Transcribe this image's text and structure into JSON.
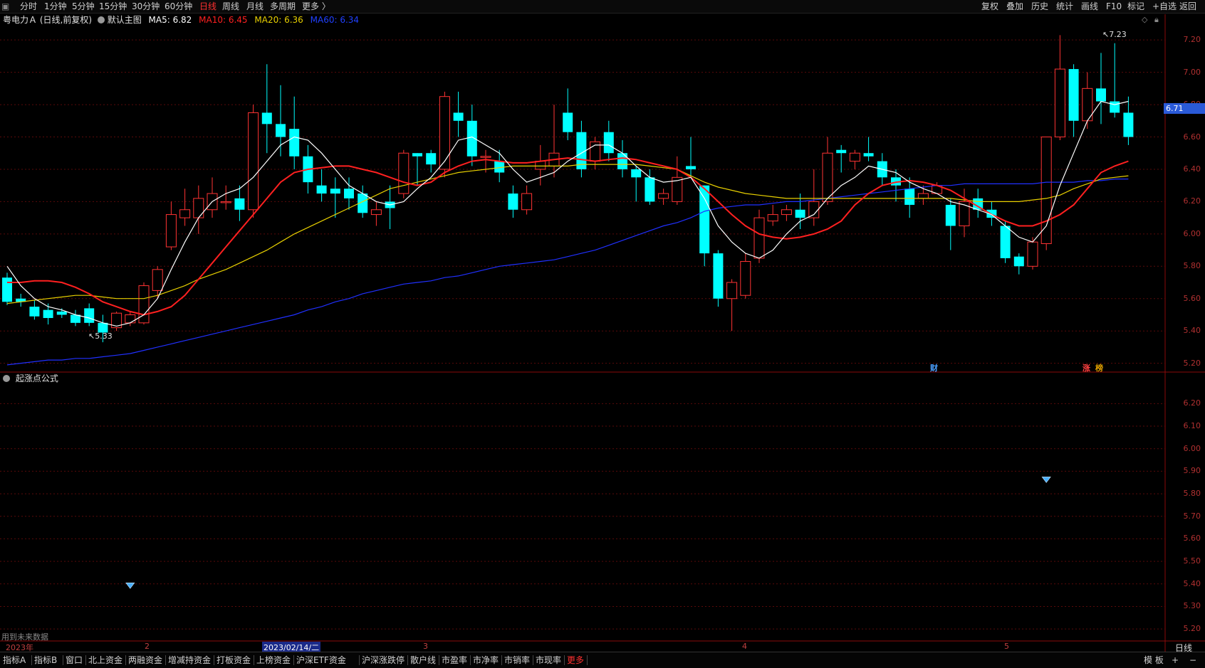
{
  "topbar": {
    "menu": [
      "分时",
      "1分钟",
      "5分钟",
      "15分钟",
      "30分钟",
      "60分钟",
      "日线",
      "周线",
      "月线",
      "多周期",
      "更多 〉"
    ],
    "active": "日线",
    "right": [
      "复权",
      "叠加",
      "历史",
      "统计",
      "画线",
      "F10",
      "标记",
      "+自选",
      "返回"
    ]
  },
  "main": {
    "stock": "粤电力Ａ",
    "period": "(日线,前复权)",
    "template": "默认主图",
    "ma5": "MA5: 6.82",
    "ma10": "MA10: 6.45",
    "ma20": "MA20: 6.36",
    "ma60": "MA60: 6.34",
    "high_note": "7.23",
    "low_note": "5.33",
    "current_price": "6.71",
    "axis": [
      "7.20",
      "7.00",
      "6.80",
      "6.60",
      "6.40",
      "6.20",
      "6.00",
      "5.80",
      "5.60",
      "5.40",
      "5.20"
    ],
    "markers": {
      "cai": "财",
      "zhang": "涨",
      "bang": "榜"
    }
  },
  "sub": {
    "title": "起涨点公式",
    "axis": [
      "6.20",
      "6.10",
      "6.00",
      "5.90",
      "5.80",
      "5.70",
      "5.60",
      "5.50",
      "5.40",
      "5.30",
      "5.20"
    ]
  },
  "dates": {
    "year": "2023年",
    "m2": "2",
    "highlight": "2023/02/14/二",
    "m3": "3",
    "m4": "4",
    "m5": "5",
    "future_note": "用到未来数据",
    "cycle": "日线"
  },
  "bottombar": {
    "items": [
      "指标A",
      "指标B",
      "窗口",
      "北上资金",
      "两融资金",
      "增减持资金",
      "打板资金",
      "上榜资金",
      "沪深ETF资金",
      "沪深涨跌停",
      "散户线",
      "市盈率",
      "市净率",
      "市销率",
      "市现率",
      "更多"
    ],
    "right": [
      "模 板",
      "+",
      "−"
    ]
  },
  "colors": {
    "up": "#ff3333",
    "down": "#00ffff",
    "ma5": "#ffffff",
    "ma10": "#ff2020",
    "ma20": "#e8d000",
    "ma60": "#2030ff",
    "grid": "#5a0a0a"
  },
  "chart_data": {
    "type": "candlestick",
    "candles": [
      [
        5.73,
        5.58,
        5.76,
        5.56
      ],
      [
        5.6,
        5.58,
        5.63,
        5.55
      ],
      [
        5.55,
        5.49,
        5.59,
        5.47
      ],
      [
        5.53,
        5.48,
        5.57,
        5.44
      ],
      [
        5.52,
        5.5,
        5.54,
        5.48
      ],
      [
        5.5,
        5.45,
        5.53,
        5.43
      ],
      [
        5.54,
        5.45,
        5.57,
        5.43
      ],
      [
        5.45,
        5.39,
        5.5,
        5.33
      ],
      [
        5.42,
        5.51,
        5.52,
        5.4
      ],
      [
        5.45,
        5.5,
        5.52,
        5.43
      ],
      [
        5.45,
        5.68,
        5.7,
        5.44
      ],
      [
        5.65,
        5.78,
        5.8,
        5.6
      ],
      [
        5.92,
        6.12,
        6.2,
        5.9
      ],
      [
        6.1,
        6.15,
        6.28,
        6.05
      ],
      [
        6.1,
        6.22,
        6.3,
        6.0
      ],
      [
        6.15,
        6.25,
        6.35,
        6.1
      ],
      [
        6.2,
        6.2,
        6.3,
        6.15
      ],
      [
        6.22,
        6.15,
        6.3,
        6.08
      ],
      [
        6.15,
        6.75,
        6.8,
        6.1
      ],
      [
        6.75,
        6.68,
        7.05,
        6.5
      ],
      [
        6.68,
        6.6,
        6.92,
        6.48
      ],
      [
        6.65,
        6.48,
        6.85,
        6.4
      ],
      [
        6.48,
        6.32,
        6.55,
        6.25
      ],
      [
        6.3,
        6.25,
        6.4,
        6.2
      ],
      [
        6.28,
        6.25,
        6.35,
        6.1
      ],
      [
        6.28,
        6.22,
        6.35,
        6.15
      ],
      [
        6.25,
        6.13,
        6.3,
        6.1
      ],
      [
        6.12,
        6.15,
        6.2,
        6.05
      ],
      [
        6.2,
        6.16,
        6.3,
        6.03
      ],
      [
        6.25,
        6.5,
        6.52,
        6.22
      ],
      [
        6.5,
        6.48,
        6.5,
        6.3
      ],
      [
        6.5,
        6.43,
        6.52,
        6.38
      ],
      [
        6.4,
        6.85,
        6.88,
        6.35
      ],
      [
        6.75,
        6.7,
        6.88,
        6.6
      ],
      [
        6.7,
        6.48,
        6.8,
        6.42
      ],
      [
        6.48,
        6.48,
        6.52,
        6.38
      ],
      [
        6.45,
        6.38,
        6.52,
        6.32
      ],
      [
        6.25,
        6.15,
        6.3,
        6.1
      ],
      [
        6.15,
        6.25,
        6.3,
        6.12
      ],
      [
        6.4,
        6.45,
        6.55,
        6.3
      ],
      [
        6.42,
        6.5,
        6.8,
        6.35
      ],
      [
        6.75,
        6.63,
        6.9,
        6.58
      ],
      [
        6.63,
        6.4,
        6.7,
        6.35
      ],
      [
        6.45,
        6.57,
        6.6,
        6.4
      ],
      [
        6.63,
        6.5,
        6.7,
        6.45
      ],
      [
        6.5,
        6.4,
        6.58,
        6.35
      ],
      [
        6.4,
        6.35,
        6.42,
        6.2
      ],
      [
        6.35,
        6.2,
        6.4,
        6.18
      ],
      [
        6.22,
        6.25,
        6.28,
        6.18
      ],
      [
        6.2,
        6.35,
        6.48,
        6.18
      ],
      [
        6.42,
        6.4,
        6.6,
        6.35
      ],
      [
        6.3,
        5.88,
        6.3,
        5.8
      ],
      [
        5.88,
        5.6,
        5.9,
        5.55
      ],
      [
        5.6,
        5.7,
        5.72,
        5.4
      ],
      [
        5.62,
        5.83,
        5.88,
        5.6
      ],
      [
        5.85,
        6.1,
        6.15,
        5.82
      ],
      [
        6.08,
        6.12,
        6.18,
        6.05
      ],
      [
        6.12,
        6.15,
        6.18,
        6.08
      ],
      [
        6.15,
        6.1,
        6.25,
        6.03
      ],
      [
        6.1,
        6.2,
        6.4,
        6.05
      ],
      [
        6.2,
        6.5,
        6.6,
        6.18
      ],
      [
        6.52,
        6.5,
        6.55,
        6.38
      ],
      [
        6.45,
        6.5,
        6.52,
        6.4
      ],
      [
        6.5,
        6.48,
        6.6,
        6.45
      ],
      [
        6.45,
        6.35,
        6.5,
        6.3
      ],
      [
        6.35,
        6.3,
        6.4,
        6.2
      ],
      [
        6.28,
        6.18,
        6.35,
        6.1
      ],
      [
        6.22,
        6.25,
        6.3,
        6.18
      ],
      [
        6.25,
        6.3,
        6.32,
        6.25
      ],
      [
        6.18,
        6.05,
        6.22,
        5.9
      ],
      [
        6.05,
        6.2,
        6.28,
        5.98
      ],
      [
        6.22,
        6.15,
        6.28,
        6.1
      ],
      [
        6.15,
        6.1,
        6.2,
        6.05
      ],
      [
        6.05,
        5.85,
        6.08,
        5.82
      ],
      [
        5.86,
        5.8,
        5.88,
        5.75
      ],
      [
        5.8,
        5.95,
        5.98,
        5.78
      ],
      [
        5.94,
        6.6,
        6.6,
        5.9
      ],
      [
        6.6,
        7.02,
        7.23,
        6.58
      ],
      [
        7.02,
        6.7,
        7.05,
        6.6
      ],
      [
        6.7,
        6.9,
        7.0,
        6.65
      ],
      [
        6.9,
        6.82,
        7.12,
        6.68
      ],
      [
        6.82,
        6.75,
        7.18,
        6.72
      ],
      [
        6.75,
        6.6,
        6.85,
        6.55
      ]
    ],
    "ma5": [
      5.8,
      5.68,
      5.6,
      5.55,
      5.53,
      5.5,
      5.48,
      5.45,
      5.43,
      5.45,
      5.5,
      5.6,
      5.78,
      5.95,
      6.1,
      6.2,
      6.25,
      6.28,
      6.35,
      6.45,
      6.55,
      6.6,
      6.58,
      6.5,
      6.4,
      6.3,
      6.25,
      6.2,
      6.18,
      6.2,
      6.28,
      6.35,
      6.45,
      6.58,
      6.6,
      6.55,
      6.5,
      6.4,
      6.32,
      6.35,
      6.38,
      6.45,
      6.5,
      6.55,
      6.55,
      6.5,
      6.42,
      6.35,
      6.32,
      6.33,
      6.35,
      6.22,
      6.05,
      5.95,
      5.88,
      5.85,
      5.9,
      6.0,
      6.08,
      6.12,
      6.22,
      6.3,
      6.35,
      6.42,
      6.4,
      6.38,
      6.32,
      6.28,
      6.25,
      6.2,
      6.18,
      6.15,
      6.12,
      6.05,
      5.98,
      5.95,
      6.05,
      6.3,
      6.5,
      6.7,
      6.82,
      6.8,
      6.82
    ],
    "ma10": [
      5.7,
      5.7,
      5.71,
      5.71,
      5.7,
      5.67,
      5.63,
      5.58,
      5.55,
      5.52,
      5.5,
      5.52,
      5.55,
      5.62,
      5.72,
      5.82,
      5.92,
      6.02,
      6.12,
      6.22,
      6.32,
      6.38,
      6.4,
      6.41,
      6.42,
      6.42,
      6.4,
      6.38,
      6.35,
      6.32,
      6.3,
      6.32,
      6.38,
      6.42,
      6.45,
      6.46,
      6.45,
      6.44,
      6.44,
      6.45,
      6.46,
      6.47,
      6.46,
      6.45,
      6.46,
      6.47,
      6.46,
      6.44,
      6.42,
      6.4,
      6.35,
      6.28,
      6.2,
      6.12,
      6.05,
      6.0,
      5.98,
      5.97,
      5.98,
      6.0,
      6.03,
      6.08,
      6.18,
      6.25,
      6.3,
      6.32,
      6.33,
      6.32,
      6.3,
      6.27,
      6.22,
      6.17,
      6.12,
      6.08,
      6.05,
      6.05,
      6.08,
      6.12,
      6.18,
      6.28,
      6.38,
      6.42,
      6.45
    ],
    "ma20": [
      5.57,
      5.58,
      5.59,
      5.6,
      5.61,
      5.62,
      5.62,
      5.61,
      5.6,
      5.6,
      5.6,
      5.62,
      5.65,
      5.68,
      5.72,
      5.75,
      5.78,
      5.82,
      5.86,
      5.9,
      5.95,
      6.0,
      6.04,
      6.08,
      6.12,
      6.16,
      6.2,
      6.24,
      6.28,
      6.3,
      6.32,
      6.34,
      6.36,
      6.38,
      6.39,
      6.4,
      6.41,
      6.42,
      6.42,
      6.42,
      6.42,
      6.42,
      6.43,
      6.43,
      6.43,
      6.43,
      6.43,
      6.42,
      6.41,
      6.4,
      6.36,
      6.32,
      6.29,
      6.27,
      6.25,
      6.24,
      6.23,
      6.22,
      6.22,
      6.22,
      6.22,
      6.22,
      6.22,
      6.22,
      6.22,
      6.22,
      6.22,
      6.22,
      6.22,
      6.22,
      6.21,
      6.2,
      6.2,
      6.2,
      6.2,
      6.21,
      6.22,
      6.24,
      6.28,
      6.31,
      6.34,
      6.35,
      6.36
    ],
    "ma60": [
      5.19,
      5.2,
      5.21,
      5.22,
      5.22,
      5.23,
      5.23,
      5.24,
      5.25,
      5.26,
      5.28,
      5.3,
      5.32,
      5.34,
      5.36,
      5.38,
      5.4,
      5.42,
      5.44,
      5.46,
      5.48,
      5.5,
      5.53,
      5.55,
      5.58,
      5.6,
      5.63,
      5.65,
      5.67,
      5.69,
      5.7,
      5.71,
      5.73,
      5.74,
      5.76,
      5.78,
      5.8,
      5.81,
      5.82,
      5.83,
      5.84,
      5.86,
      5.88,
      5.9,
      5.93,
      5.96,
      5.99,
      6.02,
      6.05,
      6.07,
      6.1,
      6.14,
      6.16,
      6.17,
      6.18,
      6.18,
      6.19,
      6.2,
      6.2,
      6.21,
      6.22,
      6.23,
      6.24,
      6.25,
      6.26,
      6.27,
      6.28,
      6.29,
      6.3,
      6.3,
      6.31,
      6.31,
      6.31,
      6.31,
      6.31,
      6.31,
      6.32,
      6.32,
      6.32,
      6.33,
      6.33,
      6.34,
      6.34
    ],
    "signals": [
      9,
      76
    ],
    "main_ylim": [
      5.15,
      7.28
    ],
    "sub_ylim": [
      5.15,
      6.28
    ]
  }
}
